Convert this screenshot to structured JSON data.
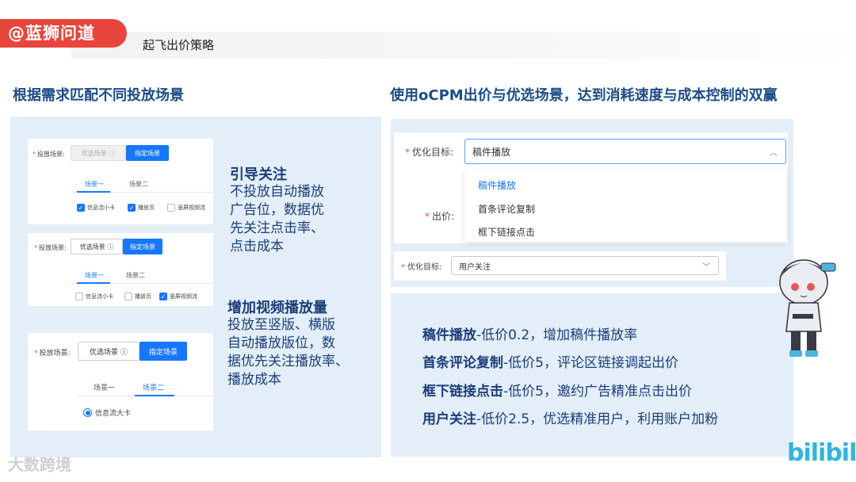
{
  "header": {
    "brand": "@蓝狮问道",
    "subtitle": "起飞出价策略"
  },
  "left": {
    "title": "根据需求匹配不同投放场景",
    "card1": {
      "field_label": "投放场景:",
      "opt_auto": "优选场景",
      "opt_manual": "指定场景",
      "tab1": "场景一",
      "tab2": "场景二",
      "checks": [
        {
          "label": "信息流小卡",
          "checked": true
        },
        {
          "label": "播放页",
          "checked": true
        },
        {
          "label": "竖屏视频流",
          "checked": false
        }
      ]
    },
    "card2": {
      "field_label": "投放场景:",
      "opt_auto": "优选场景",
      "opt_manual": "指定场景",
      "tab1": "场景一",
      "tab2": "场景二",
      "checks": [
        {
          "label": "信息流小卡",
          "checked": false
        },
        {
          "label": "播放页",
          "checked": false
        },
        {
          "label": "竖屏视频流",
          "checked": true
        }
      ]
    },
    "card3": {
      "field_label": "投放场景:",
      "opt_auto": "优选场景",
      "opt_manual": "指定场景",
      "tab1": "场景一",
      "tab2": "场景二",
      "radio_label": "信息流大卡"
    },
    "desc1": {
      "head": "引导关注",
      "lines": [
        "不投放自动播放",
        "广告位，数据优",
        "先关注点击率、",
        "点击成本"
      ]
    },
    "desc2": {
      "head": "增加视频播放量",
      "lines": [
        "投放至竖版、横版",
        "自动播放版位，数",
        "据优先关注播放率、",
        "播放成本"
      ]
    }
  },
  "right": {
    "title": "使用oCPM出价与优选场景，达到消耗速度与成本控制的双赢",
    "goal_label": "优化目标:",
    "goal_value": "稿件播放",
    "bid_label": "出价:",
    "dropdown": [
      "稿件播放",
      "首条评论复制",
      "框下链接点击"
    ],
    "goal2_label": "优化目标:",
    "goal2_value": "用户关注",
    "bullets": [
      {
        "key": "稿件播放",
        "rest": "-低价0.2，增加稿件播放率"
      },
      {
        "key": "首条评论复制",
        "rest": "-低价5，评论区链接调起出价"
      },
      {
        "key": "框下链接点击",
        "rest": "-低价5，邀约广告精准点击出价"
      },
      {
        "key": "用户关注",
        "rest": "-低价2.5，优选精准用户，利用账户加粉"
      }
    ]
  },
  "footer": {
    "watermark": "大数跨境",
    "bili_logo": "bilibili"
  },
  "colors": {
    "brand_red": "#e8453c",
    "title_blue": "#1c4d87",
    "accent_blue": "#1677ff",
    "panel_bg": "#e3eef8"
  }
}
